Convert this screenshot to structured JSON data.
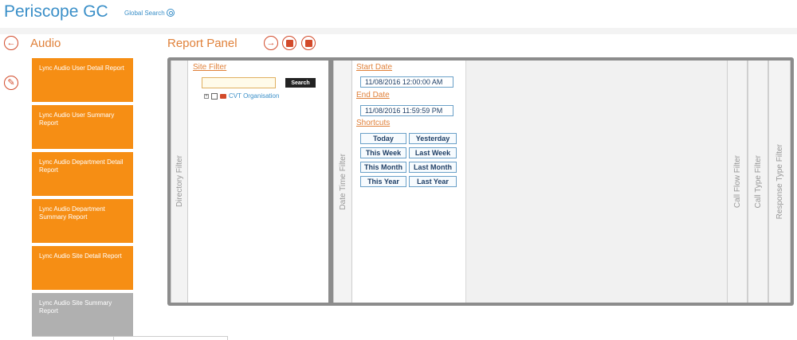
{
  "app": {
    "title": "Periscope GC",
    "global_search_label": "Global Search"
  },
  "left": {
    "section_title": "Audio",
    "reports": [
      {
        "label": "Lync Audio User Detail Report",
        "active": true
      },
      {
        "label": "Lync Audio User Summary Report",
        "active": true
      },
      {
        "label": "Lync Audio Department Detail Report",
        "active": true
      },
      {
        "label": "Lync Audio Department Summary Report",
        "active": true
      },
      {
        "label": "Lync Audio Site Detail Report",
        "active": true
      },
      {
        "label": "Lync Audio Site Summary Report",
        "active": false
      }
    ]
  },
  "panel": {
    "title": "Report Panel",
    "tabs": {
      "directory": "Directory Filter",
      "datetime": "Date Time Filter",
      "callflow": "Call Flow Filter",
      "calltype": "Call Type Filter",
      "response": "Response Type Filter"
    },
    "site_filter": {
      "label": "Site Filter",
      "search_value": "",
      "search_button": "Search",
      "tree_root": "CVT Organisation"
    },
    "date_filter": {
      "start_label": "Start Date",
      "start_value": "11/08/2016 12:00:00 AM",
      "end_label": "End Date",
      "end_value": "11/08/2016 11:59:59 PM",
      "shortcuts_label": "Shortcuts",
      "shortcuts": [
        "Today",
        "Yesterday",
        "This Week",
        "Last Week",
        "This Month",
        "Last Month",
        "This Year",
        "Last Year"
      ]
    }
  },
  "colors": {
    "brand_blue": "#3a8fc8",
    "accent_orange": "#f68e14",
    "accent_red": "#d24a2a",
    "inactive_gray": "#b0b0b0"
  }
}
